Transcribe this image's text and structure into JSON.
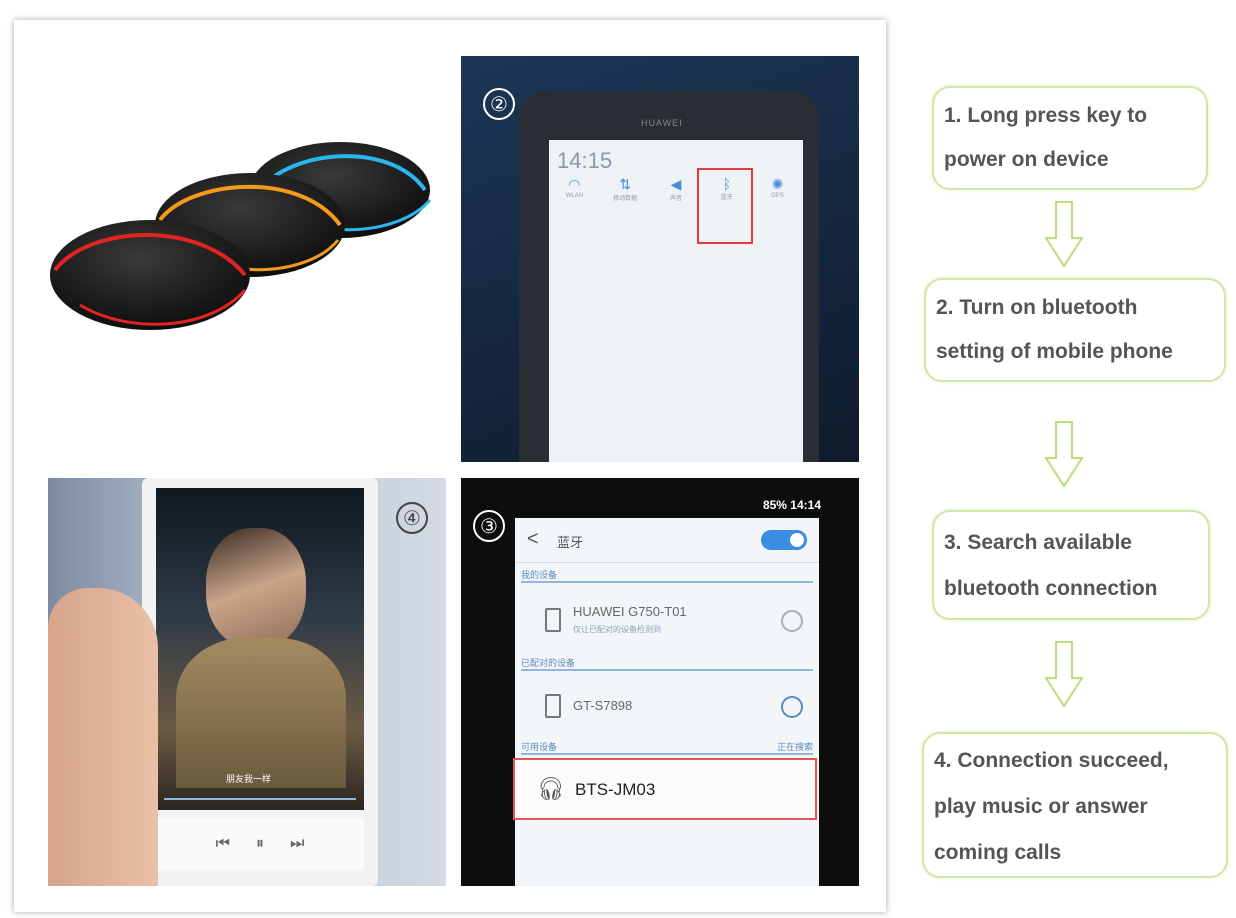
{
  "panels": {
    "p2": {
      "badge": "②",
      "time": "14:15",
      "brand": "HUAWEI",
      "toggles": [
        {
          "icon": "wifi-icon",
          "label": "WLAN"
        },
        {
          "icon": "data-icon",
          "label": "移动数据"
        },
        {
          "icon": "sound-icon",
          "label": "声音"
        },
        {
          "icon": "bluetooth-icon",
          "label": "蓝牙"
        },
        {
          "icon": "gps-icon",
          "label": "GPS"
        }
      ]
    },
    "p3": {
      "badge": "③",
      "status": "85% 14:14",
      "back": "<",
      "title": "蓝牙",
      "section_mine": "我的设备",
      "device1": "HUAWEI G750-T01",
      "device1_sub": "仅让已配对的设备检测到",
      "section_paired": "已配对的设备",
      "device2": "GT-S7898",
      "section_available": "可用设备",
      "searching": "正在搜索",
      "available_device": "BTS-JM03"
    },
    "p4": {
      "badge": "④",
      "lyric": "朋友我一样"
    }
  },
  "steps": [
    {
      "line1": "1. Long press key to",
      "line2": "power on device"
    },
    {
      "line1": "2. Turn on bluetooth",
      "line2": "setting of mobile phone"
    },
    {
      "line1": "3. Search available",
      "line2": "bluetooth connection"
    },
    {
      "line1": "4. Connection succeed,",
      "line2": "play music or answer",
      "line3": "coming calls"
    }
  ],
  "colors": {
    "step_border": "#cfe7a6",
    "highlight": "#e23a3a",
    "ring_red": "#e32222",
    "ring_orange": "#f59a1c",
    "ring_blue": "#2bb6f0"
  }
}
